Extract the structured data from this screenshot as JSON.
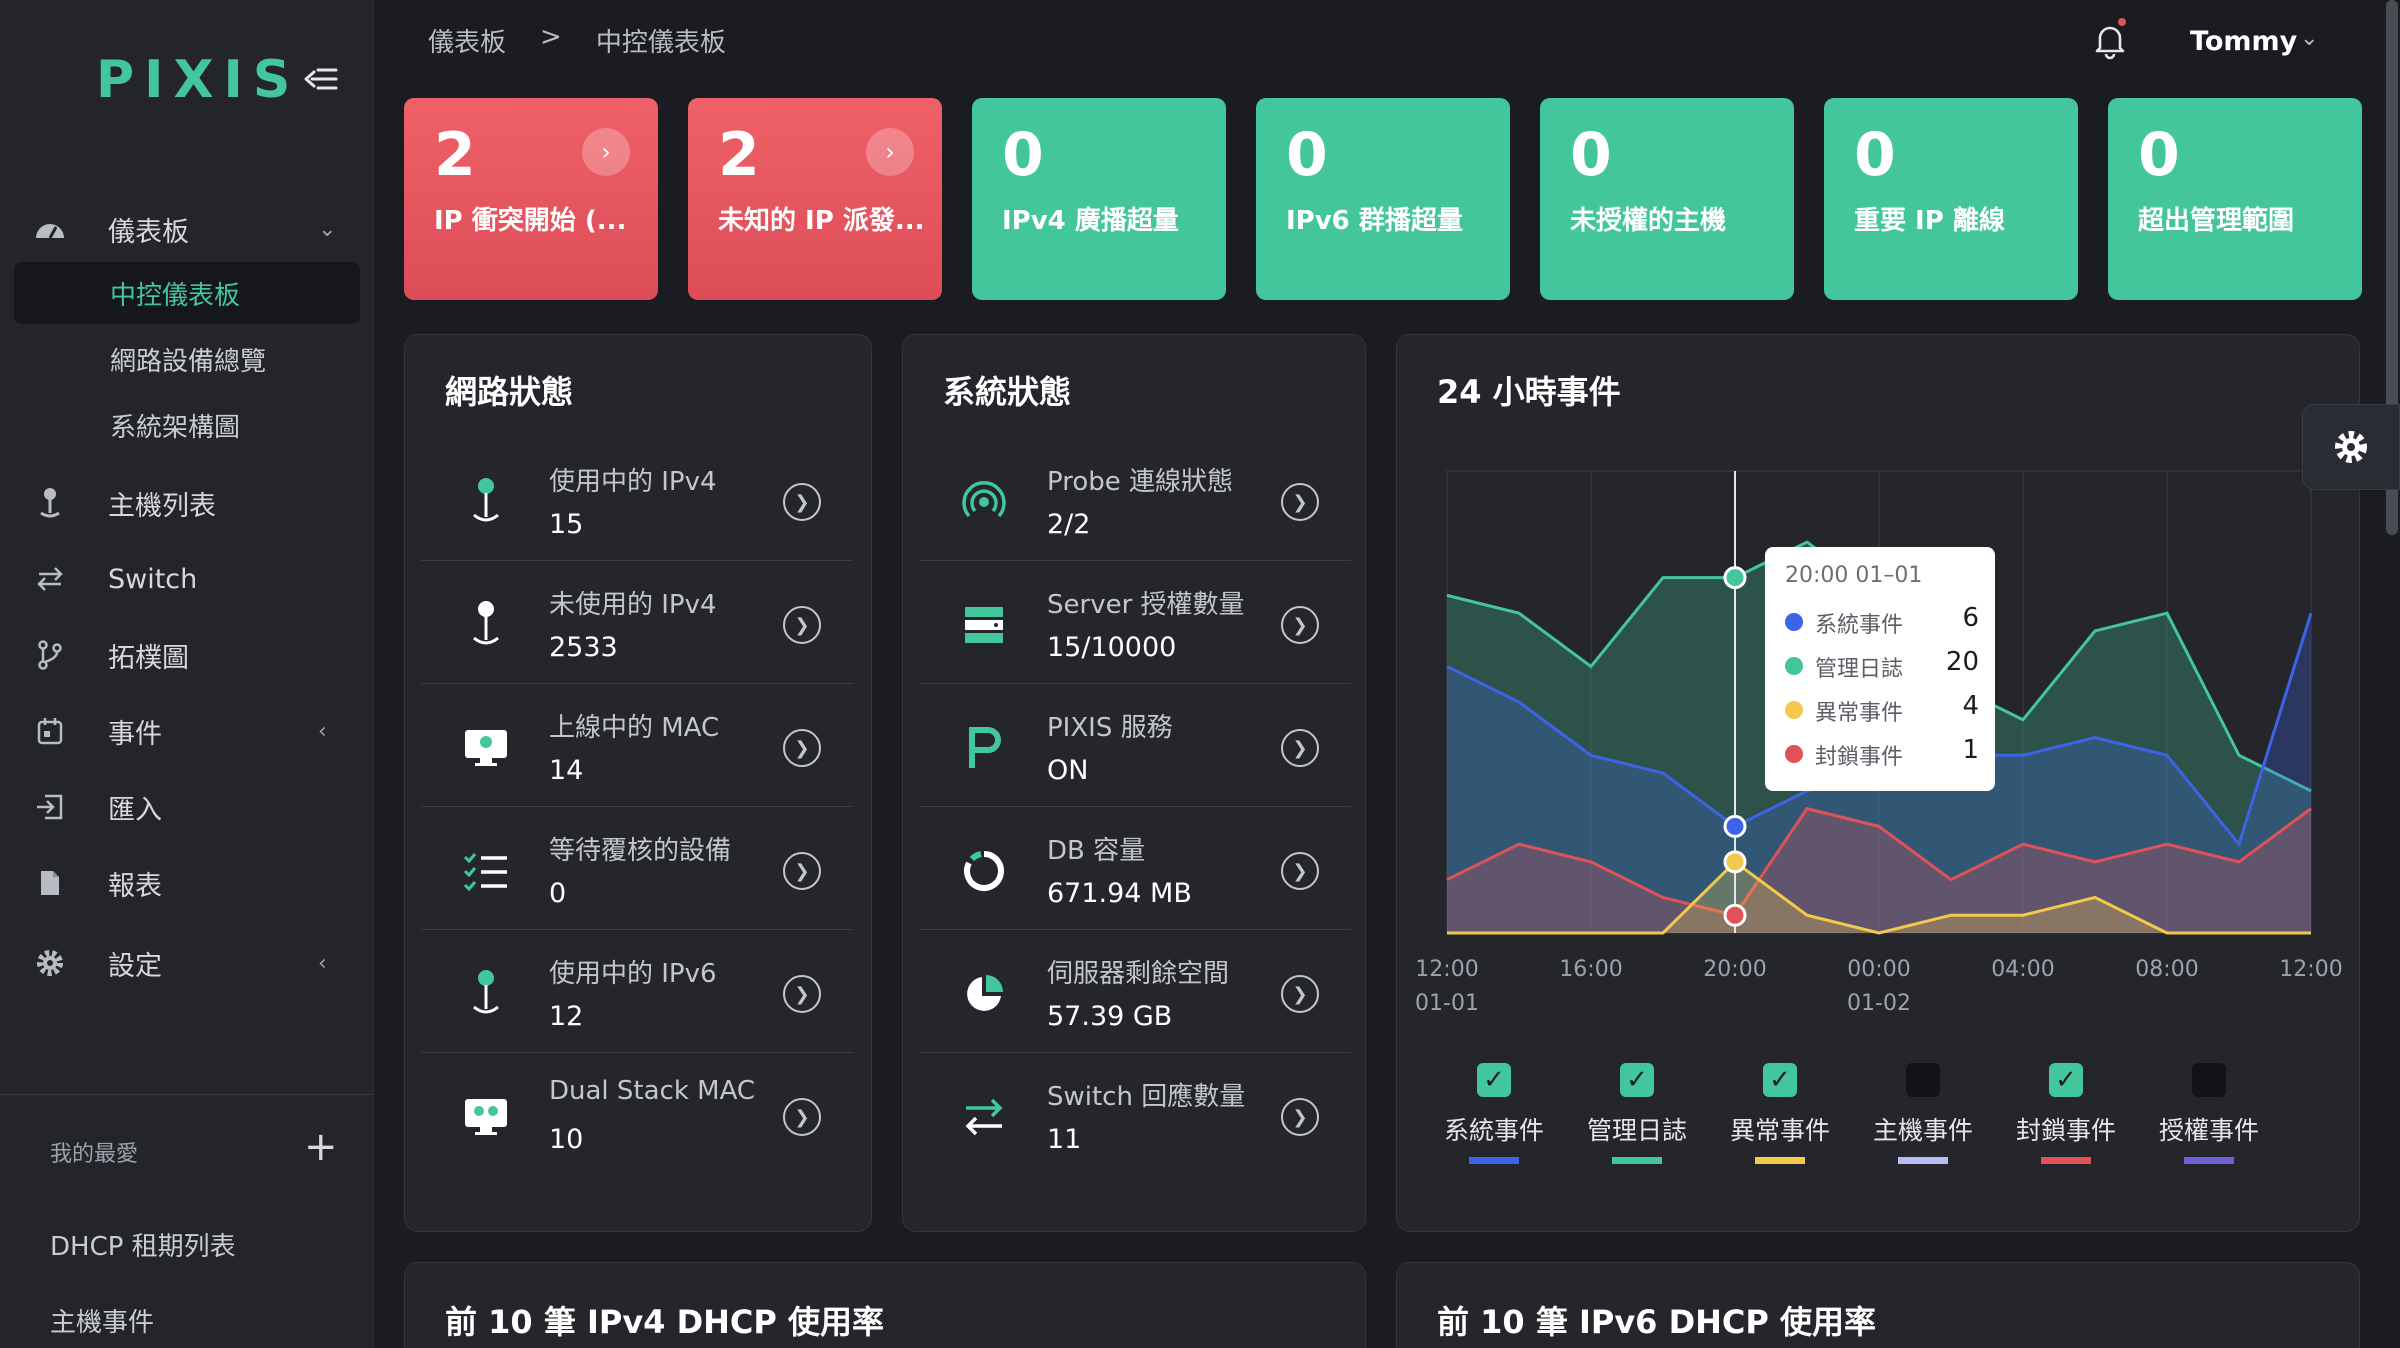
{
  "brand": {
    "logo": "PIXIS"
  },
  "header": {
    "breadcrumb": [
      "儀表板",
      ">",
      "中控儀表板"
    ],
    "user": "Tommy"
  },
  "sidebar": {
    "dashboard": "儀表板",
    "sub_items": [
      "中控儀表板",
      "網路設備總覽",
      "系統架構圖"
    ],
    "items": [
      "主機列表",
      "Switch",
      "拓樸圖",
      "事件",
      "匯入",
      "報表",
      "設定"
    ],
    "favorites_title": "我的最愛",
    "favorites": [
      "DHCP 租期列表",
      "主機事件"
    ]
  },
  "stats": [
    {
      "value": "2",
      "label": "IP 衝突開始 (...",
      "color": "red",
      "arrow": "›"
    },
    {
      "value": "2",
      "label": "未知的 IP 派發...",
      "color": "red",
      "arrow": "›"
    },
    {
      "value": "0",
      "label": "IPv4 廣播超量",
      "color": "green"
    },
    {
      "value": "0",
      "label": "IPv6 群播超量",
      "color": "green"
    },
    {
      "value": "0",
      "label": "未授權的主機",
      "color": "green"
    },
    {
      "value": "0",
      "label": "重要 IP 離線",
      "color": "green"
    },
    {
      "value": "0",
      "label": "超出管理範圍",
      "color": "green"
    }
  ],
  "network": {
    "title": "網路狀態",
    "rows": [
      {
        "label": "使用中的 IPv4",
        "value": "15"
      },
      {
        "label": "未使用的 IPv4",
        "value": "2533"
      },
      {
        "label": "上線中的 MAC",
        "value": "14"
      },
      {
        "label": "等待覆核的設備",
        "value": "0"
      },
      {
        "label": "使用中的 IPv6",
        "value": "12"
      },
      {
        "label": "Dual Stack MAC",
        "value": "10"
      }
    ]
  },
  "system": {
    "title": "系統狀態",
    "rows": [
      {
        "label": "Probe 連線狀態",
        "value": "2/2"
      },
      {
        "label": "Server 授權數量",
        "value": "15/10000"
      },
      {
        "label": "PIXIS 服務",
        "value": "ON"
      },
      {
        "label": "DB 容量",
        "value": "671.94 MB"
      },
      {
        "label": "伺服器剩餘空間",
        "value": "57.39 GB"
      },
      {
        "label": "Switch 回應數量",
        "value": "11"
      }
    ]
  },
  "events": {
    "title": "24 小時事件",
    "tooltip": {
      "title": "20:00 01–01",
      "rows": [
        {
          "label": "系統事件",
          "value": "6"
        },
        {
          "label": "管理日誌",
          "value": "20"
        },
        {
          "label": "異常事件",
          "value": "4"
        },
        {
          "label": "封鎖事件",
          "value": "1"
        }
      ]
    },
    "legend": [
      {
        "label": "系統事件",
        "checked": true,
        "color": "#3d63e6"
      },
      {
        "label": "管理日誌",
        "checked": true,
        "color": "#43c69b"
      },
      {
        "label": "異常事件",
        "checked": true,
        "color": "#f2c94c"
      },
      {
        "label": "主機事件",
        "checked": false,
        "color": "#b6bdf0"
      },
      {
        "label": "封鎖事件",
        "checked": true,
        "color": "#e05258"
      },
      {
        "label": "授權事件",
        "checked": false,
        "color": "#6f5fd8"
      }
    ]
  },
  "bottom": {
    "ipv4_title": "前 10 筆 IPv4 DHCP 使用率",
    "ipv6_title": "前 10 筆 IPv6 DHCP 使用率"
  },
  "chart_data": {
    "type": "area",
    "x_tick_labels": [
      [
        "12:00",
        "01-01"
      ],
      [
        "16:00",
        ""
      ],
      [
        "20:00",
        ""
      ],
      [
        "00:00",
        "01-02"
      ],
      [
        "04:00",
        ""
      ],
      [
        "08:00",
        ""
      ],
      [
        "12:00",
        ""
      ]
    ],
    "x": [
      0,
      2,
      4,
      6,
      8,
      10,
      12,
      14,
      16,
      18,
      20,
      22,
      24
    ],
    "ylim": [
      0,
      26
    ],
    "series": [
      {
        "name": "管理日誌",
        "color": "#43c69b",
        "values": [
          19,
          18,
          15,
          20,
          20,
          22,
          19,
          14,
          12,
          17,
          18,
          10,
          8
        ]
      },
      {
        "name": "系統事件",
        "color": "#3d63e6",
        "values": [
          15,
          13,
          10,
          9,
          6,
          8,
          9,
          10,
          10,
          11,
          10,
          5,
          18
        ]
      },
      {
        "name": "封鎖事件",
        "color": "#e05258",
        "values": [
          3,
          5,
          4,
          2,
          1,
          7,
          6,
          3,
          5,
          4,
          5,
          4,
          7
        ]
      },
      {
        "name": "異常事件",
        "color": "#f2c94c",
        "values": [
          0,
          0,
          0,
          0,
          4,
          1,
          0,
          1,
          1,
          2,
          0,
          0,
          0
        ]
      }
    ],
    "highlight_index": 4
  }
}
